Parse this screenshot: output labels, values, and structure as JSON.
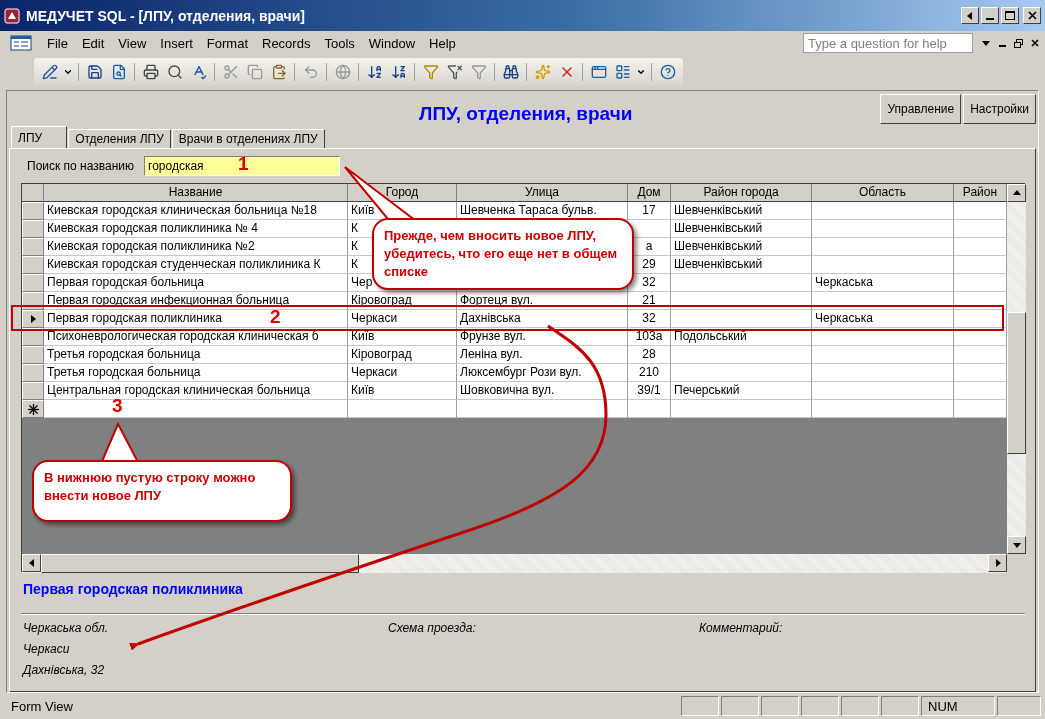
{
  "window": {
    "title": "МЕДУЧЕТ SQL - [ЛПУ, отделения, врачи]"
  },
  "menu": [
    "File",
    "Edit",
    "View",
    "Insert",
    "Format",
    "Records",
    "Tools",
    "Window",
    "Help"
  ],
  "help_search": {
    "placeholder": "Type a question for help"
  },
  "form": {
    "title": "ЛПУ, отделения, врачи",
    "buttons": [
      "Управление",
      "Настройки"
    ],
    "tabs": [
      {
        "label": "ЛПУ",
        "selected": true
      },
      {
        "label": "Отделения ЛПУ",
        "selected": false
      },
      {
        "label": "Врачи в отделениях ЛПУ",
        "selected": false
      }
    ],
    "search": {
      "label": "Поиск по названию",
      "value": "городская"
    },
    "table": {
      "columns": [
        "Название",
        "Город",
        "Улица",
        "Дом",
        "Район города",
        "Область",
        "Район"
      ],
      "rows": [
        {
          "kind": "record",
          "selected": false,
          "name": "Киевская городская клиническая больница №18",
          "city": "Київ",
          "street": "Шевченка Тараса бульв.",
          "house": "17",
          "district": "Шевченківський"
        },
        {
          "kind": "record",
          "selected": false,
          "name": "Киевская городская поликлиника № 4",
          "city": "К",
          "district": "Шевченківський"
        },
        {
          "kind": "record",
          "selected": false,
          "name": "Киевская городская поликлиника №2",
          "city": "К",
          "house": "а",
          "district": "Шевченківський"
        },
        {
          "kind": "record",
          "selected": false,
          "name": "Киевская городская студенческая поликлиника К",
          "city": "К",
          "house": "29",
          "district": "Шевченківський"
        },
        {
          "kind": "record",
          "selected": false,
          "name": "Первая городская больница",
          "city": "Чер",
          "house": "32",
          "region": "Черкаська"
        },
        {
          "kind": "record",
          "selected": false,
          "name": "Первая городская инфекционная больница",
          "city": "Кіровоград",
          "street": "Фортеця вул.",
          "house": "21"
        },
        {
          "kind": "record",
          "selected": true,
          "name": "Первая городская поликлиника",
          "city": "Черкаси",
          "street": "Дахнівська",
          "house": "32",
          "region": "Черкаська"
        },
        {
          "kind": "record",
          "selected": false,
          "name": "Психоневрологическая городская клиническая б",
          "city": "Київ",
          "street": "Фрунзе вул.",
          "house": "103а",
          "district": "Подольський"
        },
        {
          "kind": "record",
          "selected": false,
          "name": "Третья городская больница",
          "city": "Кіровоград",
          "street": "Леніна вул.",
          "house": "28"
        },
        {
          "kind": "record",
          "selected": false,
          "name": "Третья городская больница",
          "city": "Черкаси",
          "street": "Люксембург Рози вул.",
          "house": "210"
        },
        {
          "kind": "record",
          "selected": false,
          "name": "Центральная городская клиническая больница",
          "city": "Київ",
          "street": "Шовковична вул.",
          "house": "39/1",
          "district": "Печерський"
        },
        {
          "kind": "new",
          "selected": false
        }
      ]
    },
    "current_record": "Первая городская поликлиника",
    "details": {
      "region": "Черкаська обл.",
      "city": "Черкаси",
      "address": "Дахнівська, 32",
      "route_label": "Схема проезда:",
      "comment_label": "Комментарий:"
    }
  },
  "annotations": {
    "markers": [
      "1",
      "2",
      "3"
    ],
    "callouts": [
      "Прежде, чем вносить новое ЛПУ, убедитесь, что его еще нет в общем списке",
      "В нижнюю пустую строку можно внести новое ЛПУ"
    ]
  },
  "status_bar": {
    "mode": "Form View",
    "indicator": "NUM"
  }
}
